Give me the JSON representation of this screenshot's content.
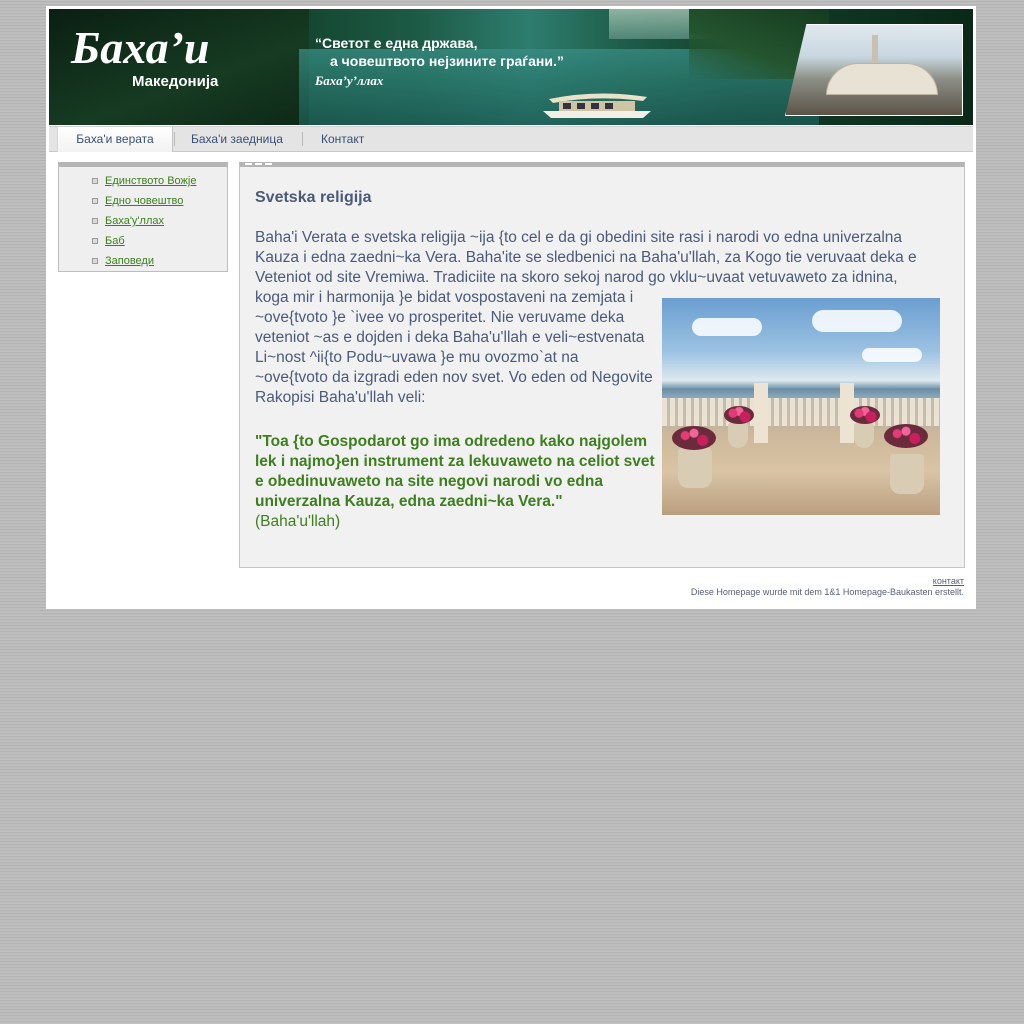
{
  "header": {
    "brand_title": "Баха’и",
    "brand_subtitle": "Македонија",
    "quote_line1": "“Светот е една држава,",
    "quote_line2": "а човештвото нејзините  граѓани.”",
    "quote_author": "Баха’у’ллах"
  },
  "nav": {
    "tabs": [
      {
        "label": "Баха'и верата",
        "active": true
      },
      {
        "label": "Баха'и заедница",
        "active": false
      },
      {
        "label": "Контакт",
        "active": false
      }
    ]
  },
  "sidebar": {
    "items": [
      {
        "label": "Единството Вожје"
      },
      {
        "label": "Едно човештво"
      },
      {
        "label": "Баха'у'ллах"
      },
      {
        "label": "Баб"
      },
      {
        "label": "Заповеди"
      }
    ]
  },
  "content": {
    "heading": "Svetska religija",
    "intro_full_lines": "Baha'i Verata e svetska religija ~ija {to cel e da gi obedini site rasi i narodi vo edna univerzalna Kauza i edna zaedni~ka Vera. Baha'ite se sledbenici na Baha'u'llah, za Kogo tie veruvaat deka e Veteniot od site Vremiwa. Tradiciite na skoro sekoj narod go vklu~uvaat vetuvaweto za idnina,",
    "intro_continued": "koga mir i harmonija }e bidat vospostaveni na zemjata i ~ove{tvoto }e `ivee vo prosperitet. Nie veruvame deka veteniot ~as e dojden i deka Baha'u'llah e veli~estvenata Li~nost ^ii{to Podu~uvawa }e mu ovozmo`at na ~ove{tvoto da izgradi eden nov svet. Vo eden od Negovite Rakopisi Baha'u'llah veli:",
    "quote": "\"Toa {to Gospodarot go ima odredeno kako najgolem lek i najmo}en instrument za lekuvaweto na celiot svet e obedinuvaweto na site negovi narodi vo edna univerzalna Kauza, edna zaedni~ka Vera.\"",
    "quote_attribution": "(Baha'u'llah)"
  },
  "footer": {
    "contact_link": "контакт",
    "note": "Diese Homepage wurde mit dem 1&1 Homepage-Baukasten erstellt."
  },
  "colors": {
    "text_blue": "#4a5a7a",
    "link_green": "#3d7f1d",
    "nav_text": "#3a4e73",
    "panel_bg": "#f1f1f1"
  }
}
